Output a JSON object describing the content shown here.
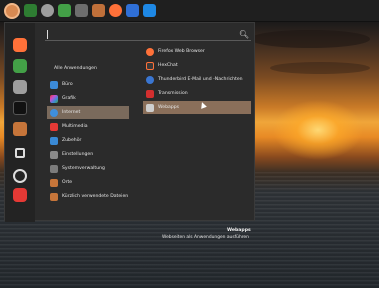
{
  "panel": {
    "icons": [
      {
        "name": "menu-icon",
        "color": "#d98a52"
      },
      {
        "name": "terminal-icon",
        "color": "#2e7d32"
      },
      {
        "name": "system-settings-icon",
        "color": "#9e9e9e"
      },
      {
        "name": "software-icon",
        "color": "#43a047"
      },
      {
        "name": "files-icon",
        "color": "#6d6d6d"
      },
      {
        "name": "folder-icon",
        "color": "#c0703a"
      },
      {
        "name": "firefox-icon",
        "color": "#ff7139"
      },
      {
        "name": "calendar-icon",
        "color": "#2f6fd6"
      },
      {
        "name": "window-icon",
        "color": "#1e88e5"
      }
    ]
  },
  "menu": {
    "search_value": "",
    "categories_header": "Alle Anwendungen",
    "categories": [
      {
        "label": "Büro",
        "icon": "office-icon",
        "color": "#3c8bd9"
      },
      {
        "label": "Grafik",
        "icon": "graphics-icon",
        "color": "#c84fd0"
      },
      {
        "label": "Internet",
        "icon": "internet-icon",
        "color": "#3f8fdc",
        "selected": true
      },
      {
        "label": "Multimedia",
        "icon": "multimedia-icon",
        "color": "#e53935"
      },
      {
        "label": "Zubehör",
        "icon": "accessories-icon",
        "color": "#3a8ad6"
      },
      {
        "label": "Einstellungen",
        "icon": "settings-icon",
        "color": "#8a8a8a"
      },
      {
        "label": "Systemverwaltung",
        "icon": "administration-icon",
        "color": "#7c7c7c"
      },
      {
        "label": "Orte",
        "icon": "places-icon",
        "color": "#c6753a"
      },
      {
        "label": "Kürzlich verwendete Dateien",
        "icon": "recent-files-icon",
        "color": "#c6753a"
      }
    ],
    "apps": [
      {
        "label": "Firefox Web Browser",
        "icon": "firefox-icon",
        "color": "#ff7139"
      },
      {
        "label": "HexChat",
        "icon": "hexchat-icon",
        "color": "#3a3a3a"
      },
      {
        "label": "Thunderbird E-Mail und -Nachrichten",
        "icon": "thunderbird-icon",
        "color": "#3a76d2"
      },
      {
        "label": "Transmission",
        "icon": "transmission-icon",
        "color": "#d32f2f"
      },
      {
        "label": "Webapps",
        "icon": "webapps-icon",
        "color": "#cfcfcf",
        "selected": true
      }
    ],
    "favorites": [
      {
        "name": "firefox-icon",
        "color": "#ff7139"
      },
      {
        "name": "software-icon",
        "color": "#43a047"
      },
      {
        "name": "system-settings-icon",
        "color": "#9e9e9e"
      },
      {
        "name": "terminal-icon",
        "color": "#1a1a1a"
      },
      {
        "name": "files-icon",
        "color": "#c6753a"
      },
      {
        "name": "lock-icon",
        "color": "#dddddd"
      },
      {
        "name": "logout-icon",
        "color": "#dddddd"
      },
      {
        "name": "power-icon",
        "color": "#e53935"
      }
    ],
    "description_title": "Webapps",
    "description_text": "Webseiten als Anwendungen ausführen"
  }
}
